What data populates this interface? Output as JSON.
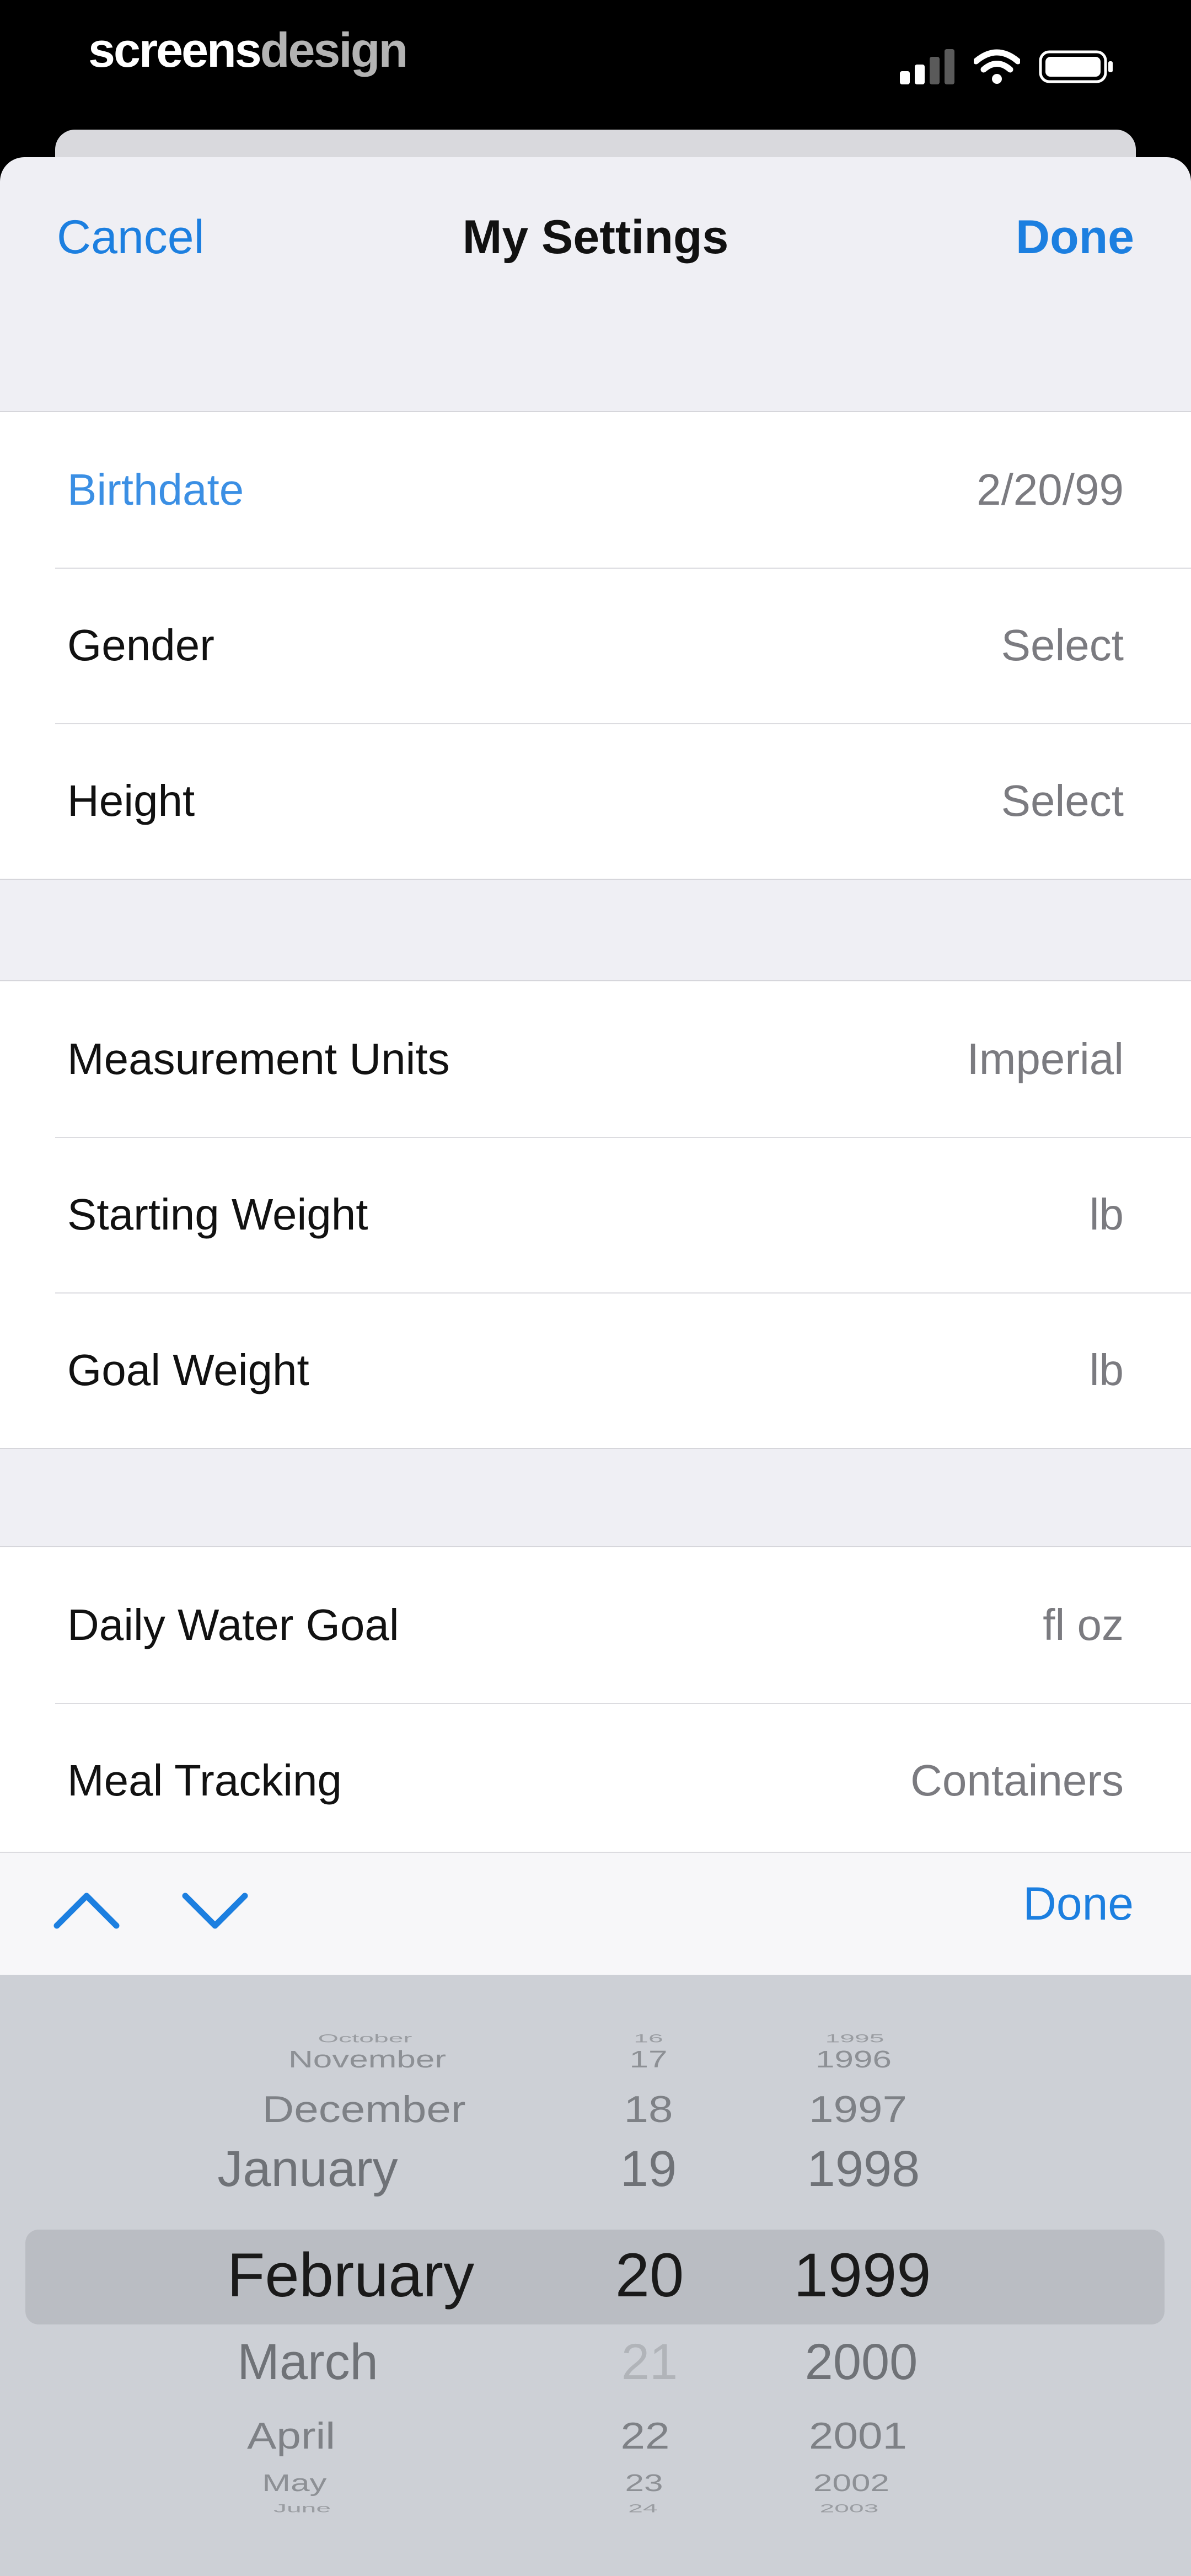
{
  "status_bar": {
    "brand_part1": "screens",
    "brand_part2": "design"
  },
  "nav": {
    "cancel": "Cancel",
    "title": "My Settings",
    "done": "Done"
  },
  "groups": [
    {
      "rows": [
        {
          "label": "Birthdate",
          "value": "2/20/99",
          "active": true
        },
        {
          "label": "Gender",
          "value": "Select"
        },
        {
          "label": "Height",
          "value": "Select"
        }
      ]
    },
    {
      "rows": [
        {
          "label": "Measurement Units",
          "value": "Imperial"
        },
        {
          "label": "Starting Weight",
          "value": "lb"
        },
        {
          "label": "Goal Weight",
          "value": "lb"
        }
      ]
    },
    {
      "rows": [
        {
          "label": "Daily Water Goal",
          "value": "fl oz"
        },
        {
          "label": "Meal Tracking",
          "value": "Containers"
        }
      ]
    }
  ],
  "toolbar": {
    "done": "Done",
    "prev_icon": "chevron-up-icon",
    "next_icon": "chevron-down-icon"
  },
  "picker": {
    "months": [
      "October",
      "November",
      "December",
      "January",
      "February",
      "March",
      "April",
      "May",
      "June"
    ],
    "days": [
      "16",
      "17",
      "18",
      "19",
      "20",
      "21",
      "22",
      "23",
      "24"
    ],
    "years": [
      "1995",
      "1996",
      "1997",
      "1998",
      "1999",
      "2000",
      "2001",
      "2002",
      "2003"
    ],
    "selected": {
      "month": "February",
      "day": "20",
      "year": "1999"
    }
  },
  "colors": {
    "accent": "#1c7fe0",
    "active_label": "#3b8fe4",
    "secondary_text": "#7b7b80",
    "picker_bg": "#cdd0d6"
  }
}
